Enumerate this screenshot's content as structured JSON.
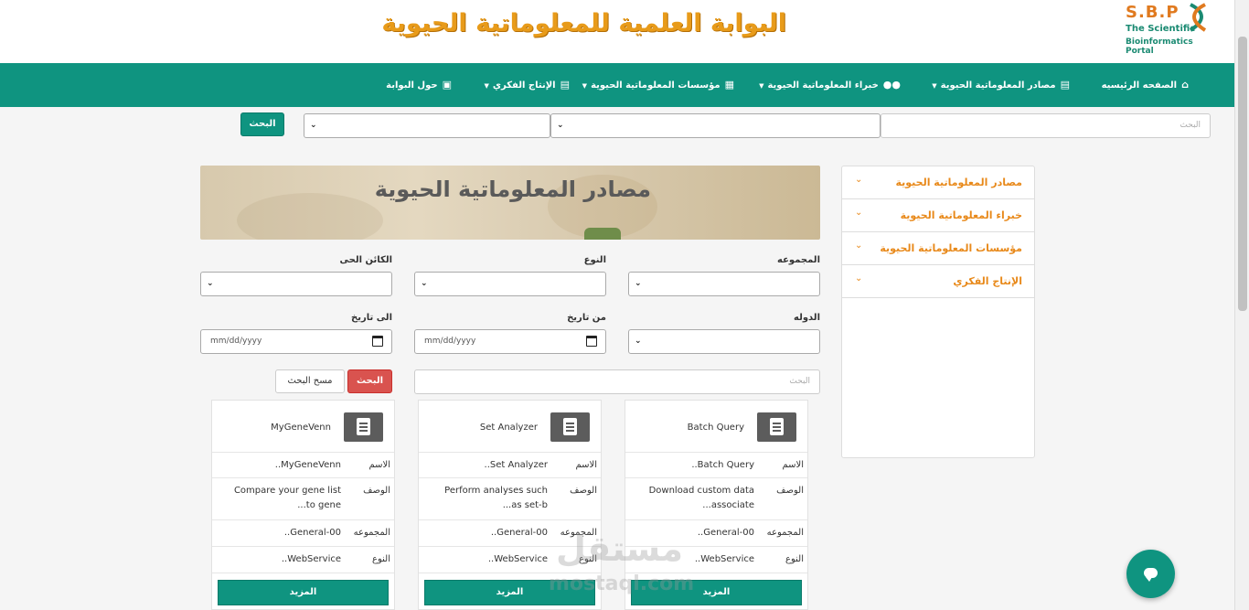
{
  "header": {
    "site_title": "البوابة العلمية للمعلوماتية الحيوية",
    "logo_abbr": "S.B.P",
    "logo_line1": "The Scientific",
    "logo_line2": "Bioinformatics Portal"
  },
  "nav": {
    "home": "الصفحه الرئيسيه",
    "sources": "مصادر المعلوماتية الحيوية",
    "experts": "خبراء المعلوماتية الحيوية",
    "institutions": "مؤسسات المعلوماتية الحيوية",
    "production": "الإنتاج الفكري",
    "about": "حول البوابة"
  },
  "top_search": {
    "placeholder": "البحث",
    "button": "البحث"
  },
  "sidebar": {
    "items": [
      {
        "label": "مصادر المعلوماتية الحيوية"
      },
      {
        "label": "خبراء المعلوماتية الحيوية"
      },
      {
        "label": "مؤسسات المعلوماتية الحيوية"
      },
      {
        "label": "الإنتاج الفكري"
      }
    ]
  },
  "banner": {
    "title": "مصادر المعلوماتية الحيوية"
  },
  "filters": {
    "collection_label": "المجموعه",
    "type_label": "النوع",
    "organism_label": "الكائن الحى",
    "country_label": "الدوله",
    "from_date_label": "من تاريخ",
    "to_date_label": "الى تاريخ",
    "date_placeholder": "mm/dd/yyyy",
    "search_placeholder": "البحث",
    "search_button": "البحث",
    "clear_button": "مسح البحث"
  },
  "cards": [
    {
      "title": "Batch Query",
      "name_label": "الاسم",
      "name": "Batch Query..",
      "desc_label": "الوصف",
      "desc": "Download custom data associate...",
      "collection_label": "المجموعه",
      "collection": "00-General..",
      "type_label": "النوع",
      "type": "WebService..",
      "more": "المزيد"
    },
    {
      "title": "Set Analyzer",
      "name_label": "الاسم",
      "name": "Set Analyzer..",
      "desc_label": "الوصف",
      "desc": "Perform analyses such as set-b...",
      "collection_label": "المجموعه",
      "collection": "00-General..",
      "type_label": "النوع",
      "type": "WebService..",
      "more": "المزيد"
    },
    {
      "title": "MyGeneVenn",
      "name_label": "الاسم",
      "name": "MyGeneVenn..",
      "desc_label": "الوصف",
      "desc": "Compare your gene list to gene...",
      "collection_label": "المجموعه",
      "collection": "00-General..",
      "type_label": "النوع",
      "type": "WebService..",
      "more": "المزيد"
    }
  ],
  "watermark": {
    "arabic": "مستقل",
    "latin": "mostaql.com"
  },
  "colors": {
    "primary": "#0f9480",
    "accent_orange": "#e8891a",
    "danger": "#d9534f"
  }
}
